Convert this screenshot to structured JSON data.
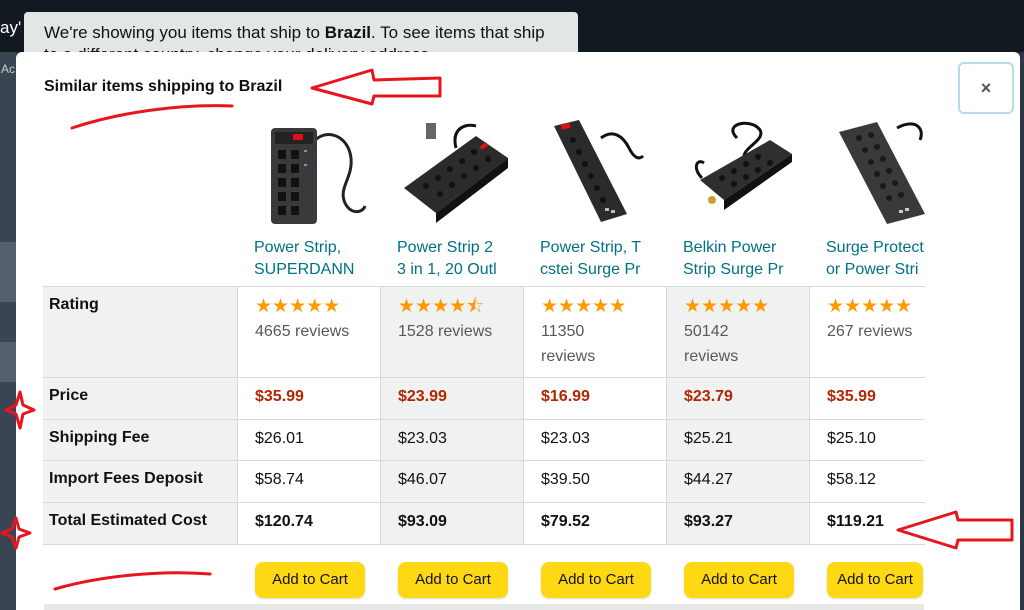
{
  "background": {
    "topbar_fragment": "ay'",
    "left_fragment": "Ac"
  },
  "notice": {
    "text_before": "We're showing you items that ship to ",
    "country": "Brazil",
    "text_after": ". To see items that ship",
    "second_line": "to a different country, change your delivery address."
  },
  "modal": {
    "title": "Similar items shipping to Brazil",
    "close_label": "×"
  },
  "row_labels": {
    "rating": "Rating",
    "price": "Price",
    "shipping": "Shipping Fee",
    "import": "Import Fees Deposit",
    "total": "Total Estimated Cost"
  },
  "products": [
    {
      "title_line1": "Power Strip,",
      "title_line2": "SUPERDANN",
      "stars": 5,
      "reviews": "4665 reviews",
      "price": "$35.99",
      "shipping": "$26.01",
      "import": "$58.74",
      "total": "$120.74",
      "cart_label": "Add to Cart"
    },
    {
      "title_line1": "Power Strip 2",
      "title_line2": "3 in 1, 20 Outl",
      "stars": 4.5,
      "reviews": "1528 reviews",
      "price": "$23.99",
      "shipping": "$23.03",
      "import": "$46.07",
      "total": "$93.09",
      "cart_label": "Add to Cart"
    },
    {
      "title_line1": "Power Strip, T",
      "title_line2": "cstei Surge Pr",
      "stars": 5,
      "reviews_line1": "11350",
      "reviews_line2": "reviews",
      "price": "$16.99",
      "shipping": "$23.03",
      "import": "$39.50",
      "total": "$79.52",
      "cart_label": "Add to Cart"
    },
    {
      "title_line1": "Belkin Power",
      "title_line2": "Strip Surge Pr",
      "stars": 5,
      "reviews_line1": "50142",
      "reviews_line2": "reviews",
      "price": "$23.79",
      "shipping": "$25.21",
      "import": "$44.27",
      "total": "$93.27",
      "cart_label": "Add to Cart"
    },
    {
      "title_line1": "Surge Protect",
      "title_line2": "or Power Stri",
      "stars": 5,
      "reviews": "267 reviews",
      "price": "$35.99",
      "shipping": "$25.10",
      "import": "$58.12",
      "total": "$119.21",
      "cart_label": "Add to Cart"
    }
  ],
  "colors": {
    "link": "#007185",
    "price": "#b12704",
    "star": "#ff9900",
    "button": "#ffd814",
    "annotation": "#e8141e"
  },
  "stars_full": "★★★★★",
  "stars_half": "★★★★⯪"
}
